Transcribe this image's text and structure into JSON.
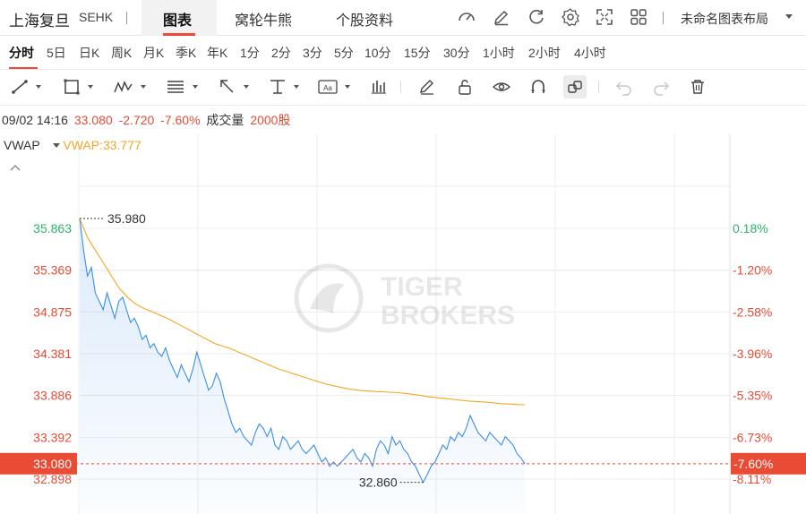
{
  "header": {
    "stock_name": "上海复旦",
    "stock_code": "SEHK",
    "tabs": [
      "图表",
      "窝轮牛熊",
      "个股资料"
    ],
    "active_tab": "图表",
    "layout_label": "未命名图表布局",
    "icons": [
      "speedometer-icon",
      "edit-icon",
      "refresh-icon",
      "settings-icon",
      "fullscreen-icon",
      "grid-layout-icon"
    ]
  },
  "periods": {
    "items": [
      "分时",
      "5日",
      "日K",
      "周K",
      "月K",
      "季K",
      "年K",
      "1分",
      "2分",
      "3分",
      "5分",
      "10分",
      "15分",
      "30分",
      "1小时",
      "2小时",
      "4小时"
    ],
    "active": "分时"
  },
  "toolbar": {
    "tools": [
      "line-tool-icon",
      "rectangle-tool-icon",
      "pattern-tool-icon",
      "fibonacci-tool-icon",
      "arrow-tool-icon",
      "measure-tool-icon",
      "text-tool-icon",
      "bars-icon",
      "pen-icon",
      "unlock-icon",
      "eye-icon",
      "magnet-icon",
      "link-icon",
      "undo-icon",
      "redo-icon",
      "trash-icon"
    ]
  },
  "quote": {
    "time": "09/02 14:16",
    "price": "33.080",
    "change": "-2.720",
    "change_pct": "-7.60%",
    "volume_label": "成交量",
    "volume": "2000股"
  },
  "indicator": {
    "name": "VWAP",
    "value_label": "VWAP:33.777"
  },
  "watermark": {
    "line1": "TIGER",
    "line2": "BROKERS"
  },
  "colors": {
    "up": "#2db36b",
    "down": "#e94b35",
    "price_line": "#3a8ee6",
    "vwap_line": "#f5a524",
    "grid": "#ececec"
  },
  "chart_data": {
    "type": "line",
    "y_ticks_left": [
      "35.863",
      "35.369",
      "34.875",
      "34.381",
      "33.886",
      "33.392",
      "32.898"
    ],
    "y_ticks_right": [
      "0.18%",
      "-1.20%",
      "-2.58%",
      "-3.96%",
      "-5.35%",
      "-6.73%",
      "-8.11%"
    ],
    "ylim": [
      32.898,
      35.863
    ],
    "prev_close": 35.8,
    "current_price": 33.08,
    "current_label_left": "33.080",
    "current_label_right": "-7.60%",
    "max_label": "35.980",
    "min_label": "32.860",
    "max_value": 35.98,
    "min_value": 32.86,
    "series": [
      {
        "values": [
          35.98,
          35.6,
          35.3,
          35.4,
          35.1,
          35.0,
          34.9,
          35.1,
          34.95,
          34.8,
          35.0,
          35.05,
          34.9,
          34.75,
          34.8,
          34.7,
          34.55,
          34.6,
          34.45,
          34.5,
          34.4,
          34.35,
          34.45,
          34.3,
          34.2,
          34.1,
          34.25,
          34.15,
          34.05,
          34.2,
          34.4,
          34.25,
          34.1,
          33.95,
          34.0,
          34.15,
          34.05,
          33.85,
          33.7,
          33.55,
          33.45,
          33.5,
          33.4,
          33.35,
          33.3,
          33.45,
          33.55,
          33.5,
          33.4,
          33.5,
          33.3,
          33.25,
          33.4,
          33.35,
          33.25,
          33.3,
          33.35,
          33.25,
          33.2,
          33.25,
          33.3,
          33.2,
          33.1,
          33.15,
          33.05,
          33.1,
          33.05,
          33.1,
          33.15,
          33.2,
          33.25,
          33.15,
          33.1,
          33.2,
          33.15,
          33.05,
          33.25,
          33.35,
          33.3,
          33.2,
          33.4,
          33.3,
          33.35,
          33.25,
          33.2,
          33.1,
          33.05,
          32.95,
          32.86,
          32.95,
          33.05,
          33.1,
          33.2,
          33.3,
          33.25,
          33.4,
          33.35,
          33.45,
          33.4,
          33.5,
          33.65,
          33.55,
          33.45,
          33.4,
          33.35,
          33.45,
          33.4,
          33.35,
          33.3,
          33.4,
          33.35,
          33.3,
          33.2,
          33.15,
          33.08
        ]
      },
      {
        "values": [
          35.98,
          35.75,
          35.6,
          35.45,
          35.3,
          35.15,
          35.05,
          34.97,
          34.92,
          34.88,
          34.84,
          34.8,
          34.75,
          34.7,
          34.65,
          34.6,
          34.55,
          34.5,
          34.47,
          34.44,
          34.4,
          34.36,
          34.32,
          34.28,
          34.24,
          34.2,
          34.17,
          34.14,
          34.11,
          34.08,
          34.05,
          34.02,
          34.0,
          33.98,
          33.96,
          33.95,
          33.94,
          33.935,
          33.93,
          33.925,
          33.92,
          33.91,
          33.9,
          33.885,
          33.87,
          33.86,
          33.85,
          33.84,
          33.83,
          33.82,
          33.815,
          33.81,
          33.8,
          33.79,
          33.785,
          33.78,
          33.777
        ]
      }
    ]
  }
}
